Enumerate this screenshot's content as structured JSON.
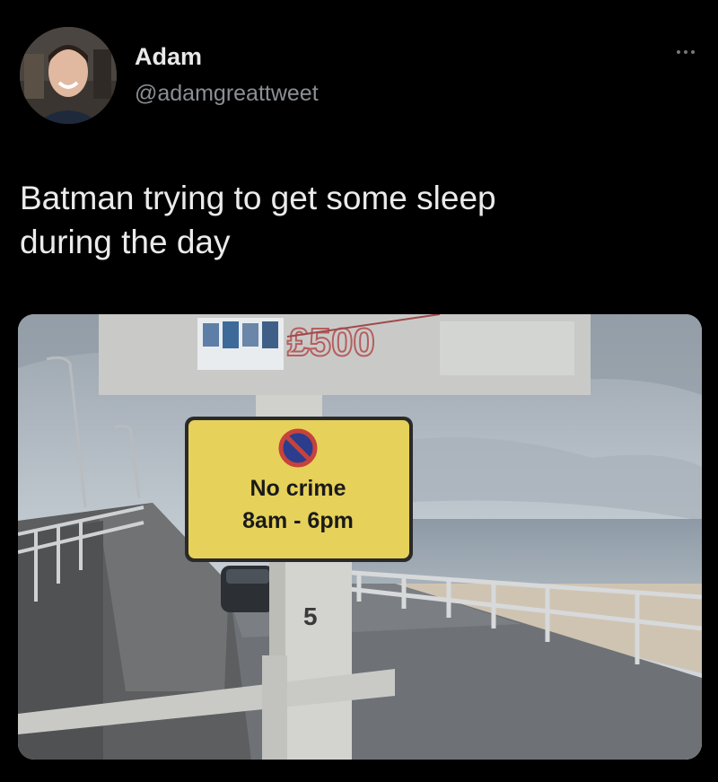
{
  "tweet": {
    "author_name": "Adam",
    "author_handle": "@adamgreattweet",
    "text_lines": [
      "Batman trying to get some sleep",
      "during the day"
    ]
  },
  "photo": {
    "board_price": "£500",
    "sign": {
      "line1": "No crime",
      "line2": "8am - 6pm"
    },
    "post_number": "5"
  },
  "icons": {
    "more": "more-options-icon"
  },
  "colors": {
    "background": "#000000",
    "text": "#ebebeb",
    "handle": "#8b8f93",
    "sign_yellow": "#e6d15a"
  }
}
